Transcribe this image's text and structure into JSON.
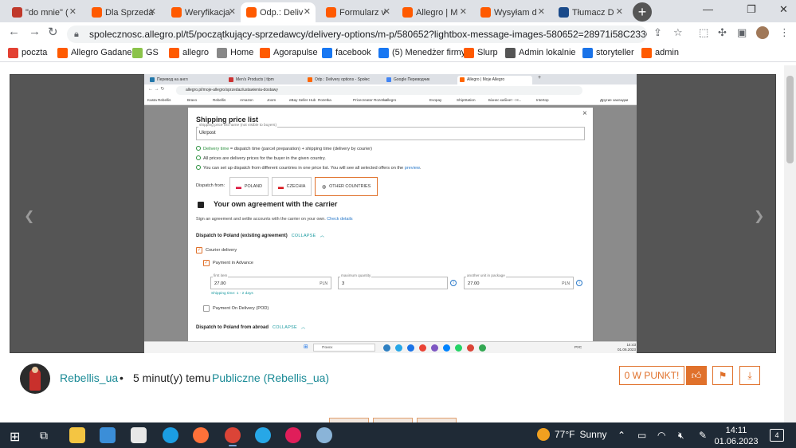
{
  "browser": {
    "tabs": [
      {
        "label": "\"do mnie\" (",
        "color": "#c0392b"
      },
      {
        "label": "Dla Sprzeda",
        "color": "#ff5a00"
      },
      {
        "label": "Weryfikacja",
        "color": "#ff5a00"
      },
      {
        "label": "Odp.: Deliv",
        "color": "#ff5a00",
        "active": true
      },
      {
        "label": "Formularz v",
        "color": "#ff5a00"
      },
      {
        "label": "Allegro | M",
        "color": "#ff5a00"
      },
      {
        "label": "Wysyłam d",
        "color": "#ff5a00"
      },
      {
        "label": "Tłumacz D",
        "color": "#1a4a8a"
      }
    ],
    "new_tab": "+",
    "url": "spolecznosc.allegro.pl/t5/początkujący-sprzedawcy/delivery-options/m-p/580652?lightbox-message-images-580652=28971i58C233C8D60C62...",
    "bookmarks": [
      {
        "label": "poczta",
        "color": "#e34133"
      },
      {
        "label": "Allegro Gadane",
        "color": "#ff5a00"
      },
      {
        "label": "GS",
        "color": "#8bc34a"
      },
      {
        "label": "allegro",
        "color": "#ff5a00"
      },
      {
        "label": "Home",
        "color": "#888888"
      },
      {
        "label": "Agorapulse",
        "color": "#ff5a00"
      },
      {
        "label": "facebook",
        "color": "#1877f2"
      },
      {
        "label": "(5) Menedżer firmy",
        "color": "#1877f2"
      },
      {
        "label": "Slurp",
        "color": "#ff5a00"
      },
      {
        "label": "Admin lokalnie",
        "color": "#555555"
      },
      {
        "label": "storyteller",
        "color": "#1a73e8"
      },
      {
        "label": "admin",
        "color": "#ff5a00"
      }
    ]
  },
  "inner": {
    "tabs": [
      "Перевод на англ",
      "Men's Products | tlpm",
      "Odp.: Delivery options - Społec",
      "Google Переводчик",
      "Allegro | Moje Allegro"
    ],
    "url": "allegro.pl/moje-allegro/sprzedaz/ustawienia-dostawy",
    "bookmarks": [
      "Kasta Rebellis",
      "Bravo",
      "Rebellis",
      "Amazon",
      "Joom",
      "eBay Seller Hub",
      "Rozetka",
      "Pricecreator Rozetka",
      "Allegro",
      "Evopay",
      "ShipStation",
      "Бізнес кабінет - H...",
      "Intertop",
      "Другие закладки"
    ],
    "modal": {
      "title": "Shipping price list",
      "close": "×",
      "name_label": "shipping price list name (not visible to buyers)",
      "name_value": "Ukrpost",
      "info1_green": "Delivery time",
      "info1_rest": " = dispatch time (parcel preparation) + shipping time (delivery by courier)",
      "info2": "All prices are delivery prices for the buyer in the given country.",
      "info3": "You can set up dispatch from different countries in one price list. You will see all selected offers on the ",
      "info3_link": "preview",
      "dispatch_from": "Dispatch from:",
      "countries": [
        "POLAND",
        "CZECHIA",
        "OTHER COUNTRIES"
      ],
      "agreement_title": "Your own agreement with the carrier",
      "agreement_sub": "Sign an agreement and settle accounts with the carrier on your own. ",
      "agreement_link": "Check details",
      "section1": "Dispatch to Poland (existing agreement)",
      "collapse": "COLLAPSE",
      "courier": "Courier delivery",
      "payment_advance": "Payment in Advance",
      "first_item_label": "first item",
      "first_item": "27.00",
      "max_qty_label": "maximum quantity",
      "max_qty": "3",
      "another_label": "another unit in package",
      "another": "27.00",
      "currency": "PLN",
      "shipping_time": "Shipping time: 1 - 2 days",
      "cod": "Payment On Delivery (POD)",
      "section2": "Dispatch to Poland from abroad"
    },
    "taskbar": {
      "search": "Поиск",
      "lang": "РУС",
      "time": "14:43",
      "date": "01.06.2023"
    }
  },
  "post": {
    "user": "Rebellis_ua",
    "dot": "•",
    "time": "5 minut(y) temu",
    "visibility": "Publiczne (Rebellis_ua)",
    "kudos": "0 W PUNKT!"
  },
  "taskbar": {
    "weather_temp": "77°F",
    "weather_desc": "Sunny",
    "time": "14:11",
    "date": "01.06.2023",
    "notifications": "4"
  },
  "colors": {
    "accent": "#e0712b",
    "link": "#1a8a96"
  }
}
